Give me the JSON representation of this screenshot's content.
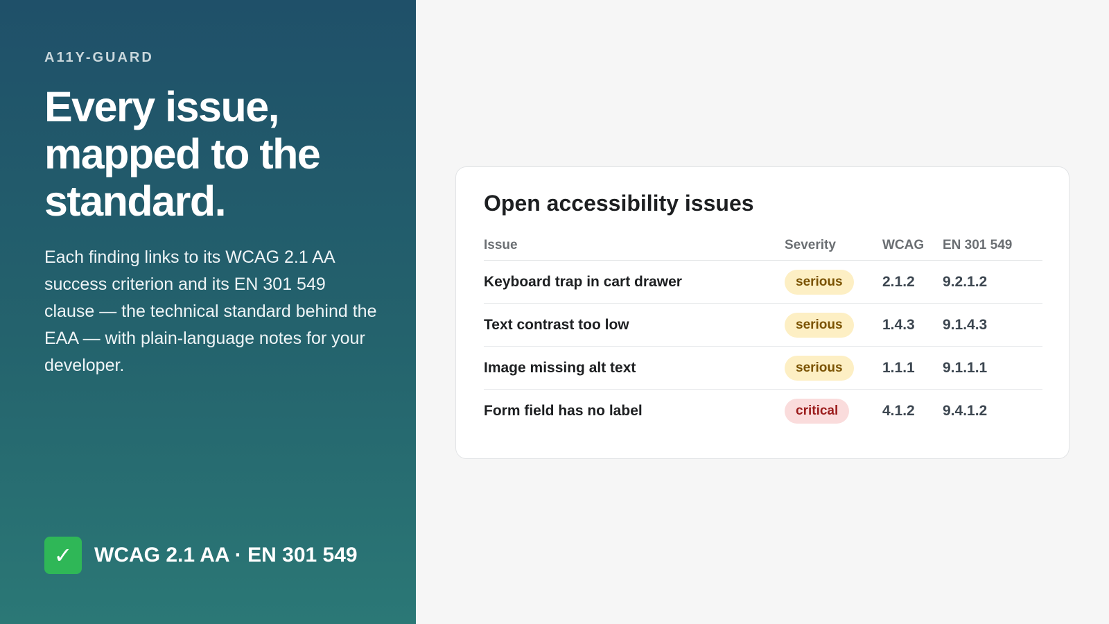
{
  "brand": "A11Y-GUARD",
  "headline": "Every issue, mapped to the standard.",
  "description": "Each finding links to its WCAG 2.1 AA success criterion and its EN 301 549 clause — the technical standard behind the EAA — with plain-language notes for your developer.",
  "badge": {
    "icon": "check-icon",
    "check_glyph": "✓",
    "text": "WCAG 2.1 AA · EN 301 549",
    "color": "#2fb757"
  },
  "card": {
    "title": "Open accessibility issues",
    "columns": [
      "Issue",
      "Severity",
      "WCAG",
      "EN 301 549"
    ],
    "rows": [
      {
        "issue": "Keyboard trap in cart drawer",
        "severity": "serious",
        "wcag": "2.1.2",
        "en": "9.2.1.2"
      },
      {
        "issue": "Text contrast too low",
        "severity": "serious",
        "wcag": "1.4.3",
        "en": "9.1.4.3"
      },
      {
        "issue": "Image missing alt text",
        "severity": "serious",
        "wcag": "1.1.1",
        "en": "9.1.1.1"
      },
      {
        "issue": "Form field has no label",
        "severity": "critical",
        "wcag": "4.1.2",
        "en": "9.4.1.2"
      }
    ]
  },
  "colors": {
    "panel_top": "#1f5069",
    "panel_bottom": "#2b7876",
    "serious_bg": "#fdefc4",
    "serious_text": "#7a5200",
    "critical_bg": "#fadcdc",
    "critical_text": "#9b1c1c"
  }
}
